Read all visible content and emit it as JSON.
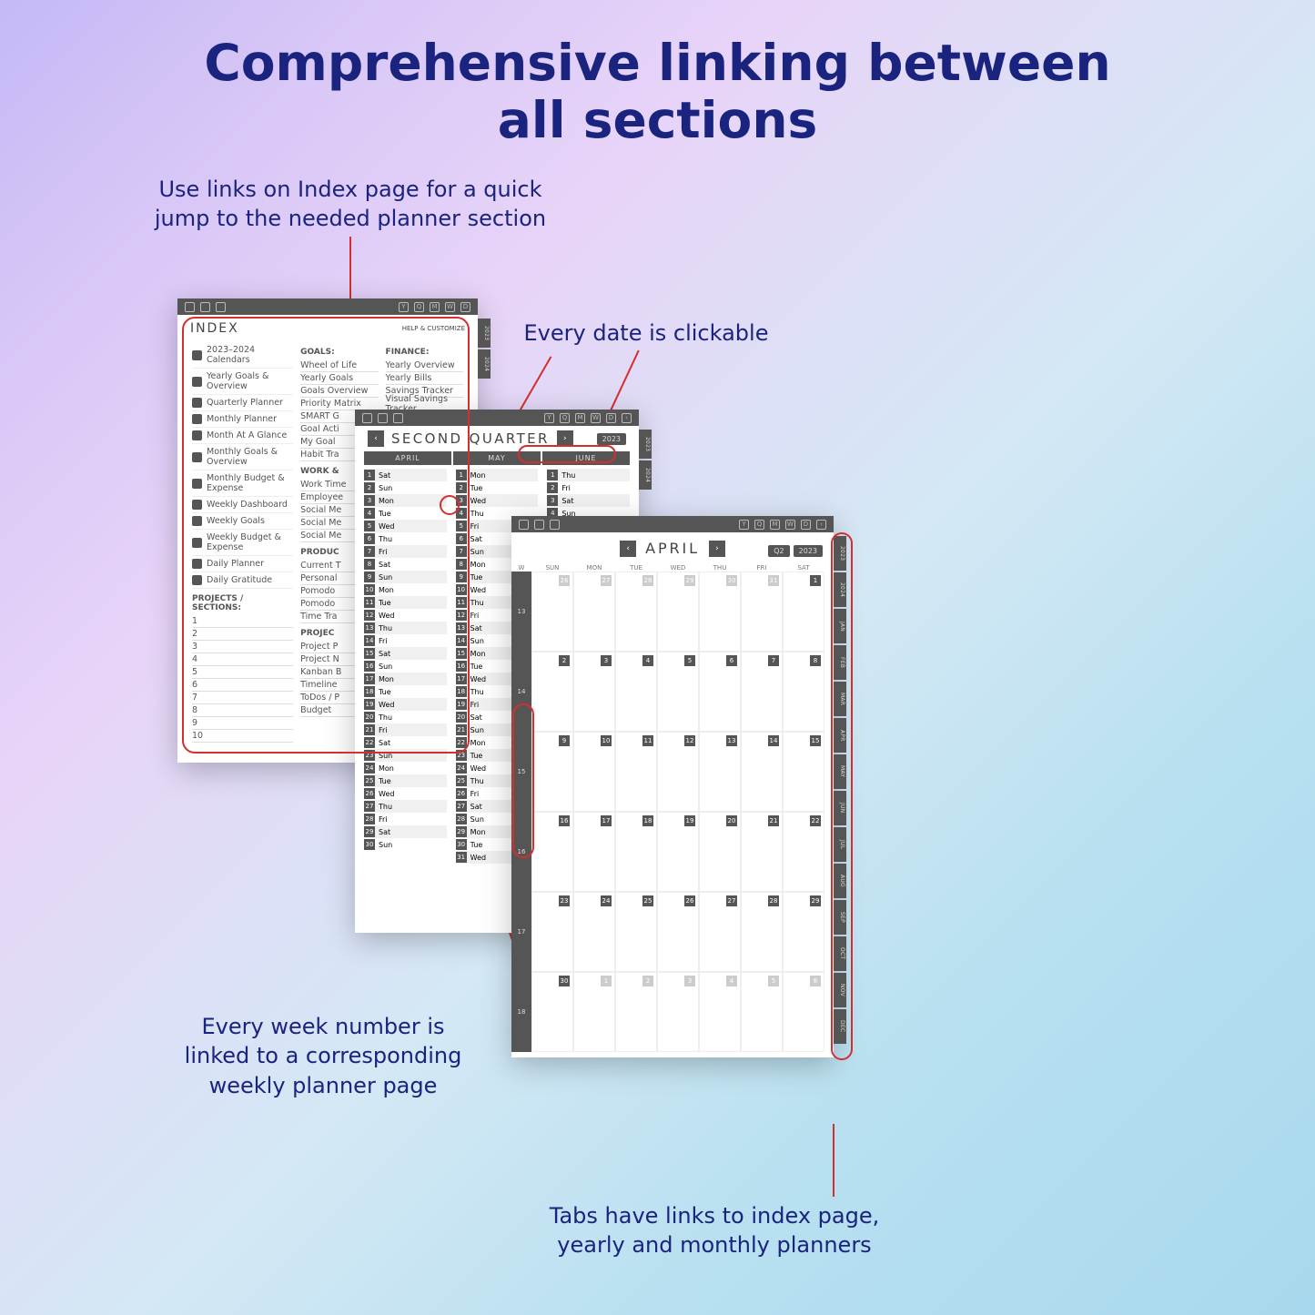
{
  "title_l1": "Comprehensive linking between",
  "title_l2": "all sections",
  "cap_index_l1": "Use links on Index page for a quick",
  "cap_index_l2": "jump to the needed planner section",
  "cap_date": "Every date is clickable",
  "cap_week_l1": "Every week number is",
  "cap_week_l2": "linked to a corresponding",
  "cap_week_l3": "weekly planner page",
  "cap_tabs_l1": "Tabs have links to index page,",
  "cap_tabs_l2": "yearly and monthly planners",
  "index": {
    "title": "INDEX",
    "help": "HELP & CUSTOMIZE",
    "left": [
      "2023–2024 Calendars",
      "Yearly Goals & Overview",
      "Quarterly Planner",
      "Monthly Planner",
      "Month At A Glance",
      "Monthly Goals & Overview",
      "Monthly Budget & Expense",
      "Weekly Dashboard",
      "Weekly Goals",
      "Weekly Budget & Expense",
      "Daily Planner",
      "Daily Gratitude"
    ],
    "projects_h": "PROJECTS / SECTIONS:",
    "projects": [
      "1",
      "2",
      "3",
      "4",
      "5",
      "6",
      "7",
      "8",
      "9",
      "10"
    ],
    "mid": {
      "goals_h": "GOALS:",
      "goals": [
        "Wheel of Life",
        "Yearly Goals",
        "Goals Overview",
        "Priority Matrix",
        "SMART G",
        "Goal Acti",
        "My Goal",
        "Habit Tra"
      ],
      "work_h": "WORK &",
      "work": [
        "Work Time",
        "Employee",
        "Social Me",
        "Social Me",
        "Social Me"
      ],
      "prod_h": "PRODUC",
      "prod": [
        "Current T",
        "Personal",
        "Pomodo",
        "Pomodo",
        "Time Tra"
      ],
      "proj_h": "PROJEC",
      "proj": [
        "Project P",
        "Project N",
        "Kanban B",
        "Timeline",
        "ToDos / P",
        "Budget"
      ]
    },
    "right": {
      "fin_h": "FINANCE:",
      "fin": [
        "Yearly Overview",
        "Yearly Bills",
        "Savings Tracker",
        "Visual Savings Tracker"
      ]
    },
    "tabs": [
      "2023",
      "2024"
    ]
  },
  "quarter": {
    "title": "SECOND QUARTER",
    "year": "2023",
    "months": [
      "APRIL",
      "MAY",
      "JUNE"
    ],
    "april": [
      "Sat",
      "Sun",
      "Mon",
      "Tue",
      "Wed",
      "Thu",
      "Fri",
      "Sat",
      "Sun",
      "Mon",
      "Tue",
      "Wed",
      "Thu",
      "Fri",
      "Sat",
      "Sun",
      "Mon",
      "Tue",
      "Wed",
      "Thu",
      "Fri",
      "Sat",
      "Sun",
      "Mon",
      "Tue",
      "Wed",
      "Thu",
      "Fri",
      "Sat",
      "Sun"
    ],
    "may": [
      "Mon",
      "Tue",
      "Wed",
      "Thu",
      "Fri",
      "Sat",
      "Sun",
      "Mon",
      "Tue",
      "Wed",
      "Thu",
      "Fri",
      "Sat",
      "Sun",
      "Mon",
      "Tue",
      "Wed",
      "Thu",
      "Fri",
      "Sat",
      "Sun",
      "Mon",
      "Tue",
      "Wed",
      "Thu",
      "Fri",
      "Sat",
      "Sun",
      "Mon",
      "Tue",
      "Wed"
    ],
    "june": [
      "Thu",
      "Fri",
      "Sat",
      "Sun"
    ],
    "tabs": [
      "2023",
      "2024"
    ]
  },
  "month": {
    "title": "APRIL",
    "q": "Q2",
    "year": "2023",
    "days": [
      "SUN",
      "MON",
      "TUE",
      "WED",
      "THU",
      "FRI",
      "SAT"
    ],
    "dayh": "W",
    "weeks": [
      "13",
      "14",
      "15",
      "16",
      "17",
      "18"
    ],
    "cells": [
      [
        "26d",
        "27d",
        "28d",
        "29d",
        "30d",
        "31d",
        "1"
      ],
      [
        "2",
        "3",
        "4",
        "5",
        "6",
        "7",
        "8"
      ],
      [
        "9",
        "10",
        "11",
        "12",
        "13",
        "14",
        "15"
      ],
      [
        "16",
        "17",
        "18",
        "19",
        "20",
        "21",
        "22"
      ],
      [
        "23",
        "24",
        "25",
        "26",
        "27",
        "28",
        "29"
      ],
      [
        "30",
        "1d",
        "2d",
        "3d",
        "4d",
        "5d",
        "6d"
      ]
    ],
    "tabs": [
      "2023",
      "2024",
      "JAN",
      "FEB",
      "MAR",
      "APR",
      "MAY",
      "JUN",
      "JUL",
      "AUG",
      "SEP",
      "OCT",
      "NOV",
      "DEC"
    ]
  }
}
